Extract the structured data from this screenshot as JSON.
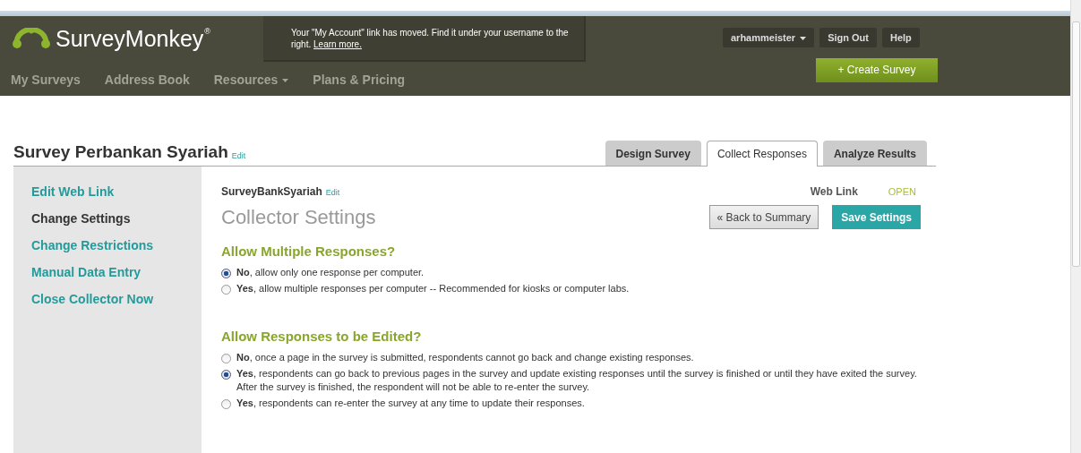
{
  "header": {
    "logo": {
      "name": "SurveyMonkey",
      "mark": "®"
    },
    "notice": {
      "text": "Your \"My Account\" link has moved. Find it under your username to the right.",
      "link": "Learn more."
    },
    "nav": [
      {
        "label": "My Surveys",
        "dropdown": false
      },
      {
        "label": "Address Book",
        "dropdown": false
      },
      {
        "label": "Resources",
        "dropdown": true
      },
      {
        "label": "Plans & Pricing",
        "dropdown": false
      }
    ],
    "user_menu": [
      {
        "label": "arhammeister",
        "dropdown": true
      },
      {
        "label": "Sign Out",
        "dropdown": false
      },
      {
        "label": "Help",
        "dropdown": false
      }
    ],
    "create_button": "+ Create Survey"
  },
  "survey": {
    "title": "Survey Perbankan Syariah",
    "edit": "Edit"
  },
  "tabs": [
    {
      "label": "Design Survey",
      "selected": false
    },
    {
      "label": "Collect Responses",
      "selected": true
    },
    {
      "label": "Analyze Results",
      "selected": false
    }
  ],
  "sidebar": {
    "items": [
      {
        "label": "Edit Web Link",
        "selected": false
      },
      {
        "label": "Change Settings",
        "selected": true
      },
      {
        "label": "Change Restrictions",
        "selected": false
      },
      {
        "label": "Manual Data Entry",
        "selected": false
      },
      {
        "label": "Close Collector Now",
        "selected": false
      }
    ]
  },
  "collector": {
    "name": "SurveyBankSyariah",
    "edit": "Edit",
    "type_label": "Web Link",
    "status": "OPEN"
  },
  "heading": "Collector Settings",
  "buttons": [
    {
      "label": "« Back to Summary",
      "kind": "secondary"
    },
    {
      "label": "Save Settings",
      "kind": "primary"
    }
  ],
  "sections": [
    {
      "title": "Allow Multiple Responses?",
      "options": [
        {
          "text": "**No**, allow only one response per computer.",
          "checked": true
        },
        {
          "text": "**Yes**, allow multiple responses per computer -- Recommended for kiosks or computer labs.",
          "checked": false
        }
      ]
    },
    {
      "title": "Allow Responses to be Edited?",
      "options": [
        {
          "text": "**No**, once a page in the survey is submitted, respondents cannot go back and change existing responses.",
          "checked": false
        },
        {
          "text": "**Yes**, respondents can go back to previous pages in the survey and update existing responses until the survey is finished or until they have exited the survey. After the survey is finished, the respondent will not be able to re-enter the survey.",
          "checked": true
        },
        {
          "text": "**Yes**, respondents can re-enter the survey at any time to update their responses.",
          "checked": false
        }
      ]
    }
  ]
}
